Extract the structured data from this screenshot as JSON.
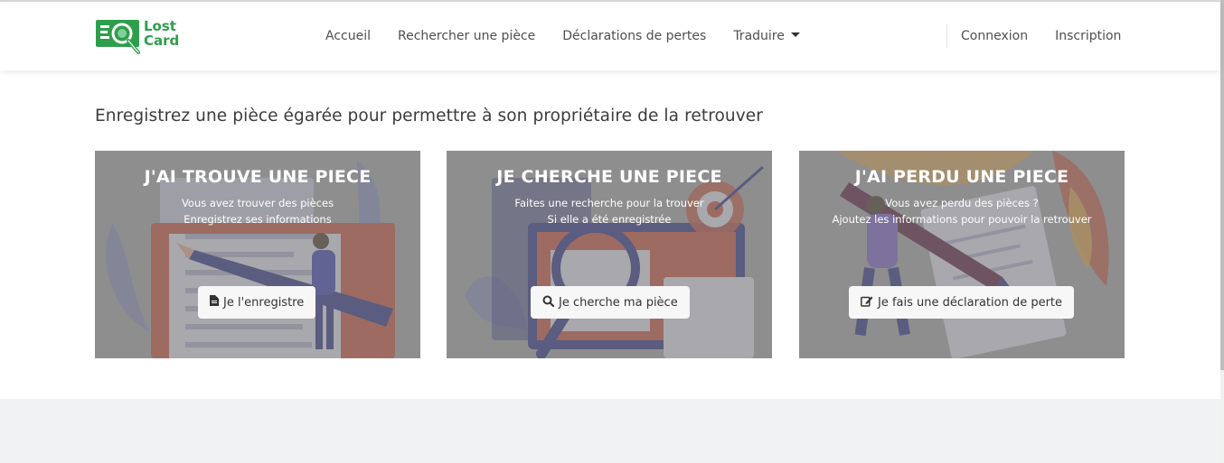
{
  "logo": {
    "line1": "Lost",
    "line2": "Card",
    "icon": "magnifier-card-icon",
    "color": "#2e9e4c"
  },
  "nav": {
    "links": [
      "Accueil",
      "Rechercher une pièce",
      "Déclarations de pertes"
    ],
    "dropdown": "Traduire",
    "right": [
      "Connexion",
      "Inscription"
    ]
  },
  "heading": "Enregistrez une pièce égarée pour permettre à son propriétaire de la retrouver",
  "cards": [
    {
      "title": "J'AI TROUVE UNE PIECE",
      "line1": "Vous avez trouver des pièces",
      "line2": "Enregistrez ses informations",
      "button": "Je l'enregistre",
      "button_icon": "document-icon"
    },
    {
      "title": "JE CHERCHE UNE PIECE",
      "line1": "Faites une recherche pour la trouver",
      "line2": "Si elle a été enregistrée",
      "button": "Je cherche ma pièce",
      "button_icon": "search-icon"
    },
    {
      "title": "J'AI PERDU UNE PIECE",
      "line1": "Vous avez perdu des pièces ?",
      "line2": "Ajoutez les informations pour pouvoir la retrouver",
      "button": "Je fais une déclaration de perte",
      "button_icon": "edit-icon"
    }
  ],
  "colors": {
    "brand": "#2e9e4c",
    "card_overlay": "#808080",
    "footer_bg": "#f1f2f4"
  }
}
